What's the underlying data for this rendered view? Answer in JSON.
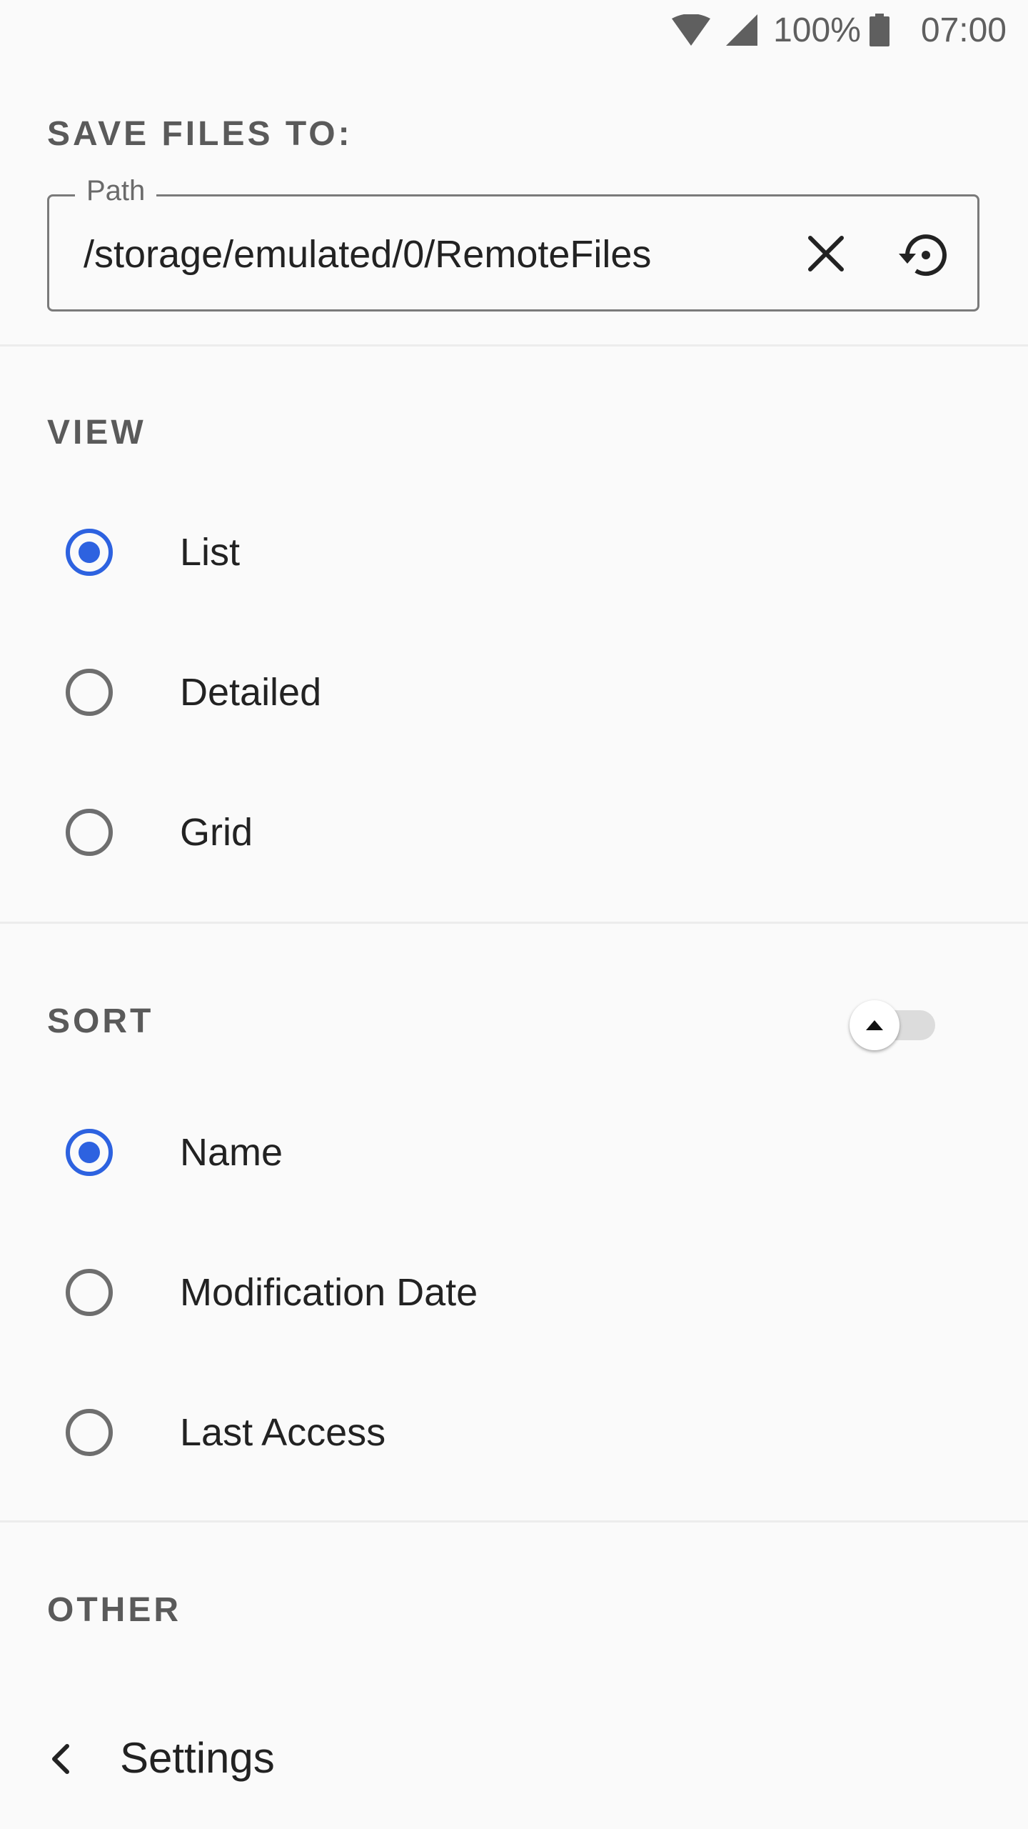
{
  "status_bar": {
    "battery": "100%",
    "time": "07:00",
    "icons": [
      "wifi-icon",
      "cell-signal-icon",
      "battery-icon"
    ]
  },
  "save_files": {
    "title": "SAVE FILES TO:",
    "path_label": "Path",
    "path_value": "/storage/emulated/0/RemoteFiles",
    "clear_icon": "close-icon",
    "reset_icon": "restore-icon"
  },
  "view": {
    "title": "VIEW",
    "options": [
      {
        "label": "List",
        "selected": true
      },
      {
        "label": "Detailed",
        "selected": false
      },
      {
        "label": "Grid",
        "selected": false
      }
    ]
  },
  "sort": {
    "title": "SORT",
    "ascending": false,
    "toggle_icon": "arrow-up-icon",
    "options": [
      {
        "label": "Name",
        "selected": true
      },
      {
        "label": "Modification Date",
        "selected": false
      },
      {
        "label": "Last Access",
        "selected": false
      }
    ]
  },
  "other": {
    "title": "OTHER"
  },
  "bottom_bar": {
    "title": "Settings",
    "back_icon": "chevron-left-icon"
  },
  "colors": {
    "accent": "#2d62e0",
    "background": "#fafafa",
    "section_title": "#5a5a5a"
  }
}
